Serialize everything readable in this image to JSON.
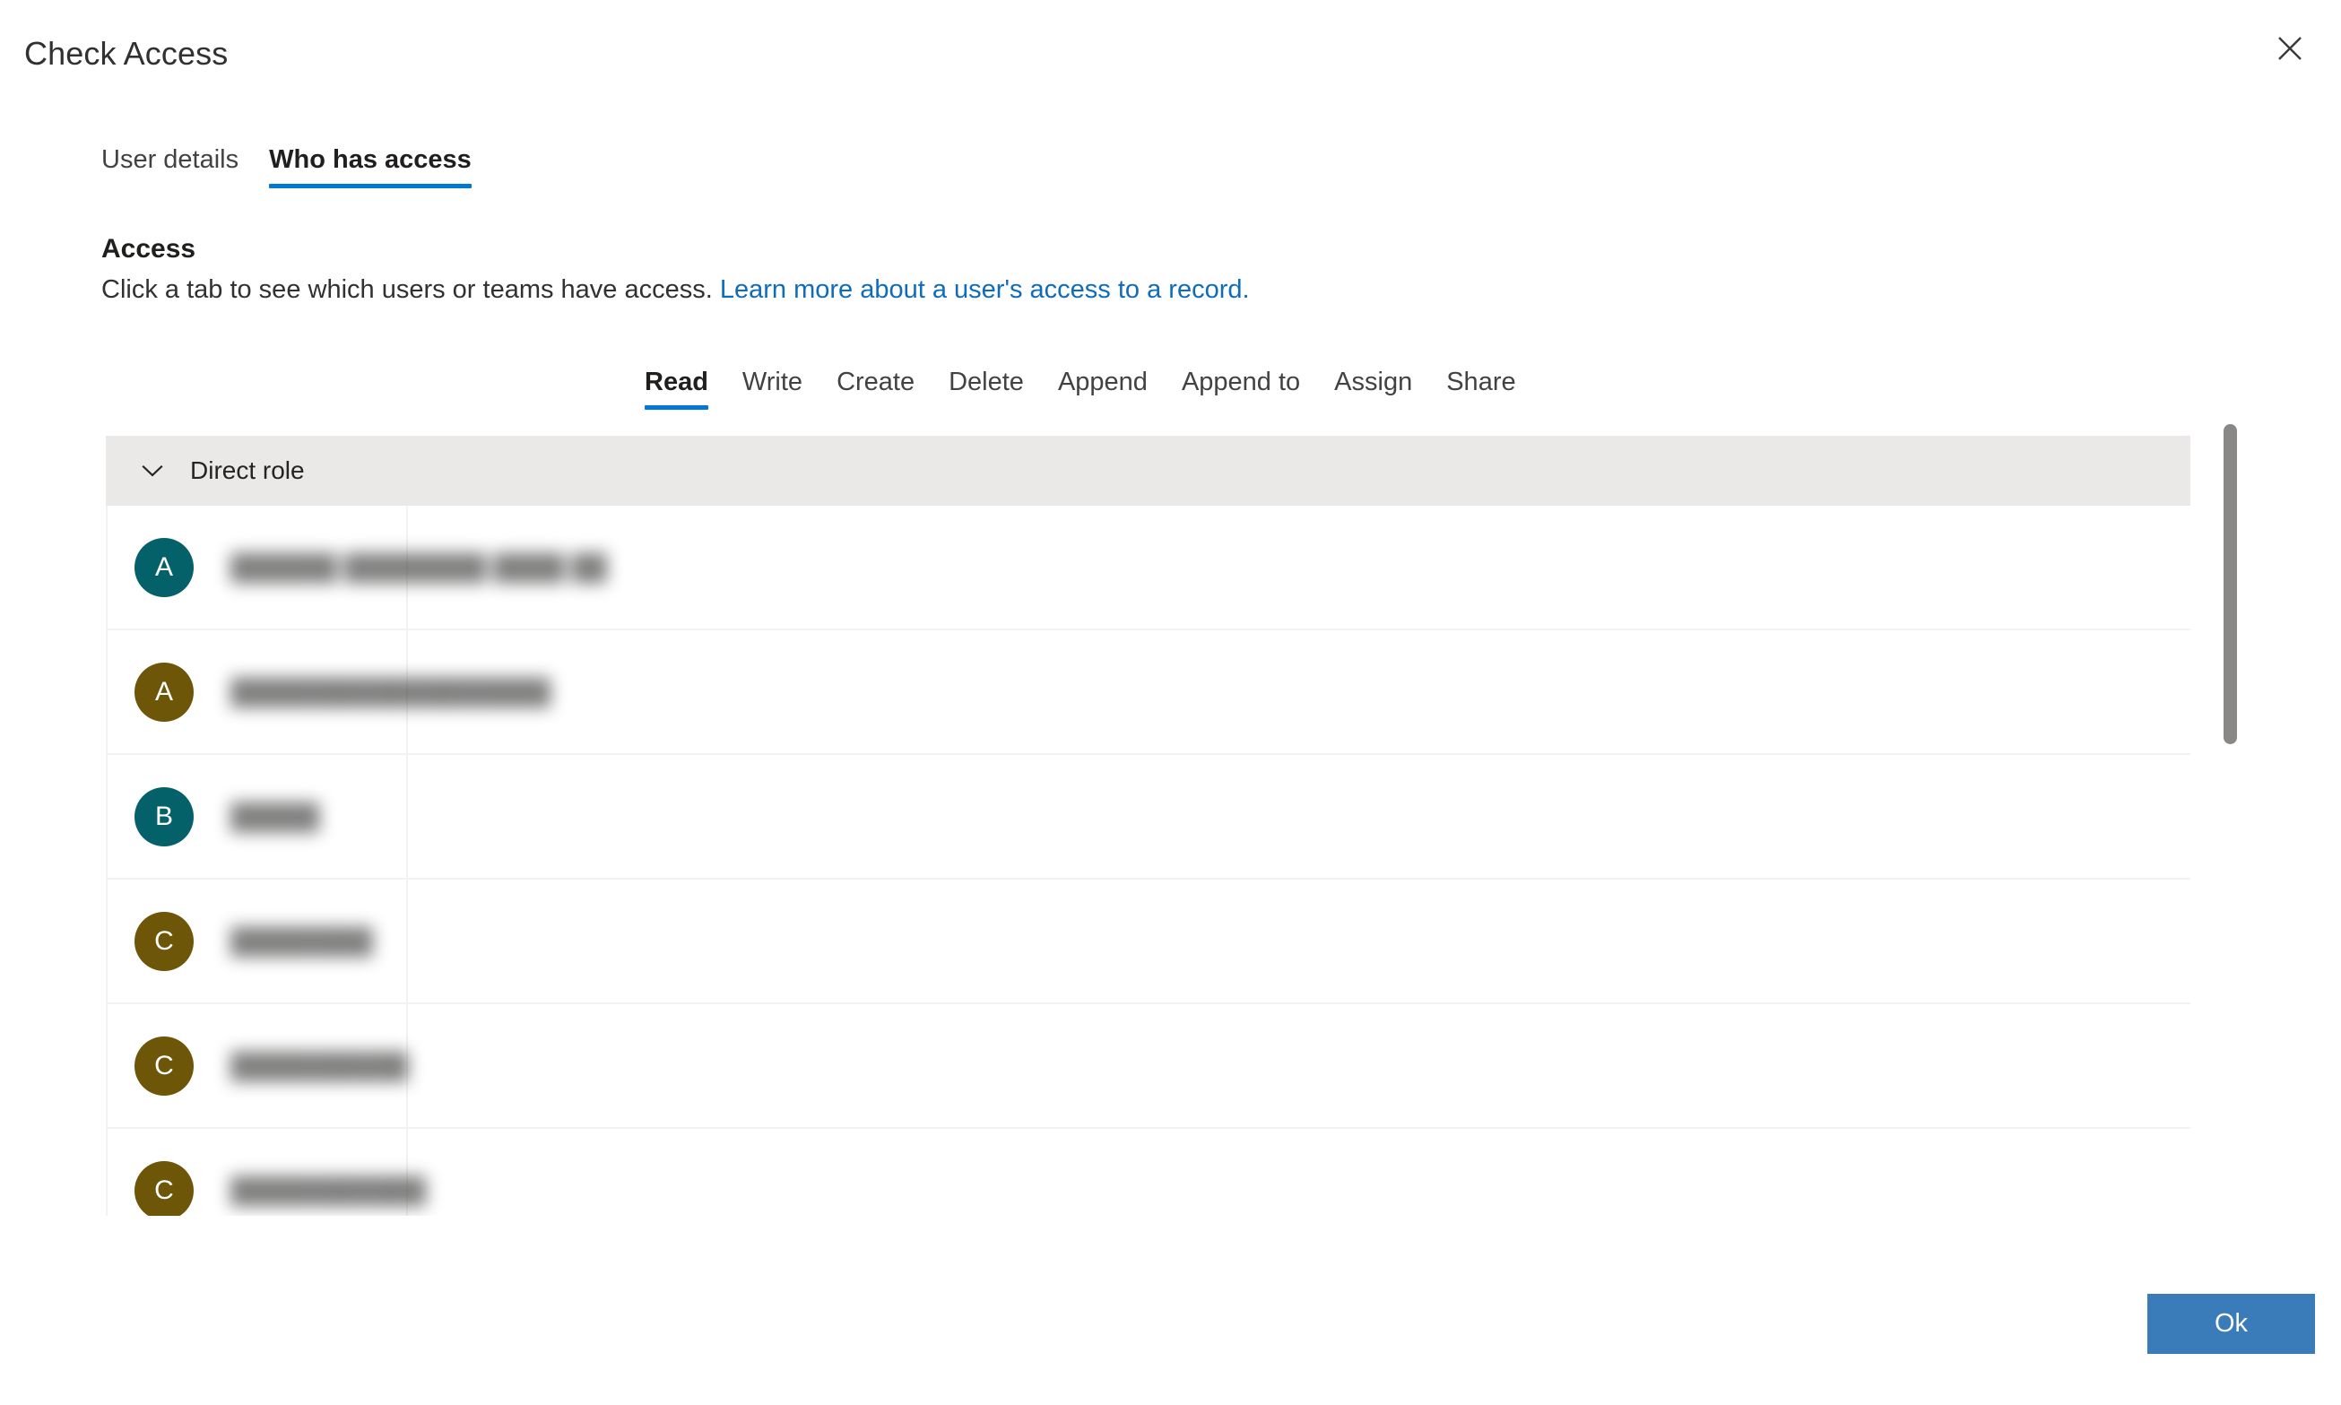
{
  "dialog": {
    "title": "Check Access",
    "close_icon": "close-icon"
  },
  "pivot": {
    "tabs": [
      {
        "label": "User details",
        "selected": false
      },
      {
        "label": "Who has access",
        "selected": true
      }
    ]
  },
  "access": {
    "heading": "Access",
    "description": "Click a tab to see which users or teams have access.",
    "link_text": "Learn more about a user's access to a record."
  },
  "permission_tabs": [
    {
      "label": "Read",
      "selected": true
    },
    {
      "label": "Write",
      "selected": false
    },
    {
      "label": "Create",
      "selected": false
    },
    {
      "label": "Delete",
      "selected": false
    },
    {
      "label": "Append",
      "selected": false
    },
    {
      "label": "Append to",
      "selected": false
    },
    {
      "label": "Assign",
      "selected": false
    },
    {
      "label": "Share",
      "selected": false
    }
  ],
  "group": {
    "label": "Direct role",
    "expanded": true,
    "chevron_icon": "chevron-down-icon"
  },
  "rows": [
    {
      "initial": "A",
      "avatar_color": "#04616a",
      "name": "██████  ████████  ████ ██"
    },
    {
      "initial": "A",
      "avatar_color": "#6e5608",
      "name": "██████████████████"
    },
    {
      "initial": "B",
      "avatar_color": "#04616a",
      "name": "█████"
    },
    {
      "initial": "C",
      "avatar_color": "#6e5608",
      "name": "████████"
    },
    {
      "initial": "C",
      "avatar_color": "#6e5608",
      "name": "██████████"
    },
    {
      "initial": "C",
      "avatar_color": "#6e5608",
      "name": "███████████"
    }
  ],
  "scrollbar": {
    "name": "list-scrollbar"
  },
  "footer": {
    "ok_label": "Ok",
    "ok_color": "#3a7cb9"
  },
  "colors": {
    "accent": "#0078d4",
    "link": "#0f6cbd",
    "group_header_bg": "#ebe9e7",
    "avatar_teal": "#04616a",
    "avatar_olive": "#6e5608"
  }
}
